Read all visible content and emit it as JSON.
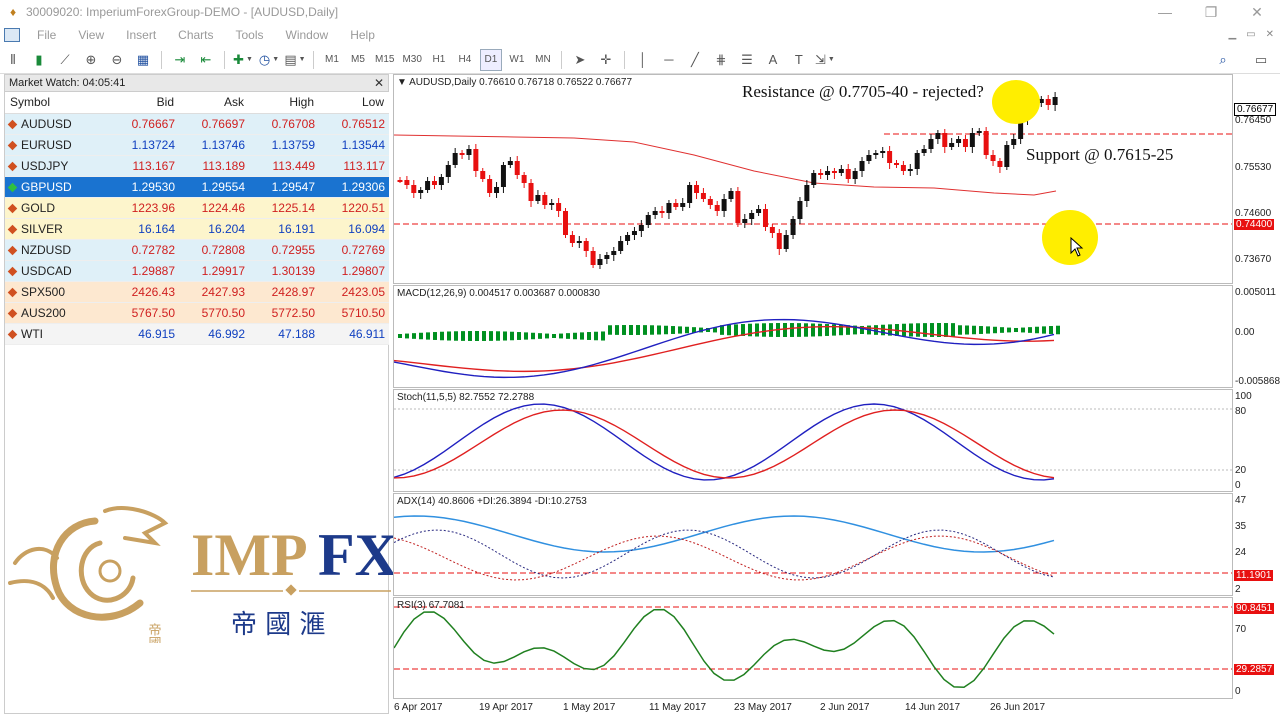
{
  "window": {
    "title": "30009020: ImperiumForexGroup-DEMO - [AUDUSD,Daily]",
    "buttons": [
      "—",
      "❐",
      "✕"
    ]
  },
  "menu": [
    "File",
    "View",
    "Insert",
    "Charts",
    "Tools",
    "Window",
    "Help"
  ],
  "toolbar": {
    "timeframes": [
      "M1",
      "M5",
      "M15",
      "M30",
      "H1",
      "H4",
      "D1",
      "W1",
      "MN"
    ],
    "active_timeframe": "D1"
  },
  "market_watch": {
    "title": "Market Watch: 04:05:41",
    "columns": [
      "Symbol",
      "Bid",
      "Ask",
      "High",
      "Low"
    ],
    "rows": [
      {
        "symbol": "AUDUSD",
        "bid": "0.76667",
        "ask": "0.76697",
        "high": "0.76708",
        "low": "0.76512",
        "bg": "#dff0f8",
        "color": "#d02020"
      },
      {
        "symbol": "EURUSD",
        "bid": "1.13724",
        "ask": "1.13746",
        "high": "1.13759",
        "low": "1.13544",
        "bg": "#dff0f8",
        "color": "#1040c0"
      },
      {
        "symbol": "USDJPY",
        "bid": "113.167",
        "ask": "113.189",
        "high": "113.449",
        "low": "113.117",
        "bg": "#dff0f8",
        "color": "#d02020"
      },
      {
        "symbol": "GBPUSD",
        "bid": "1.29530",
        "ask": "1.29554",
        "high": "1.29547",
        "low": "1.29306",
        "bg": "#1a73d0",
        "color": "#ffffff",
        "selected": true
      },
      {
        "symbol": "GOLD",
        "bid": "1223.96",
        "ask": "1224.46",
        "high": "1225.14",
        "low": "1220.51",
        "bg": "#fdf5cc",
        "color": "#d02020"
      },
      {
        "symbol": "SILVER",
        "bid": "16.164",
        "ask": "16.204",
        "high": "16.191",
        "low": "16.094",
        "bg": "#fdf5cc",
        "color": "#1040c0"
      },
      {
        "symbol": "NZDUSD",
        "bid": "0.72782",
        "ask": "0.72808",
        "high": "0.72955",
        "low": "0.72769",
        "bg": "#dff0f8",
        "color": "#d02020"
      },
      {
        "symbol": "USDCAD",
        "bid": "1.29887",
        "ask": "1.29917",
        "high": "1.30139",
        "low": "1.29807",
        "bg": "#dff0f8",
        "color": "#d02020"
      },
      {
        "symbol": "SPX500",
        "bid": "2426.43",
        "ask": "2427.93",
        "high": "2428.97",
        "low": "2423.05",
        "bg": "#fde8d0",
        "color": "#d02020"
      },
      {
        "symbol": "AUS200",
        "bid": "5767.50",
        "ask": "5770.50",
        "high": "5772.50",
        "low": "5710.50",
        "bg": "#fde8d0",
        "color": "#d02020"
      },
      {
        "symbol": "WTI",
        "bid": "46.915",
        "ask": "46.992",
        "high": "47.188",
        "low": "46.911",
        "bg": "#f4f4f4",
        "color": "#1040c0"
      }
    ]
  },
  "logo": {
    "text_a": "IMP",
    "text_b": "FX",
    "chinese": "帝 國 滙",
    "seal": "帝國"
  },
  "chart": {
    "price_label": "AUDUSD,Daily  0.76610 0.76718 0.76522 0.76677",
    "macd_label": "MACD(12,26,9) 0.004517 0.003687 0.000830",
    "stoch_label": "Stoch(11,5,5) 82.7552 72.2788",
    "adx_label": "ADX(14) 40.8606 +DI:26.3894 -DI:10.2753",
    "rsi_label": "RSI(3) 67.7081",
    "annotation_resistance": "Resistance @ 0.7705-40 - rejected?",
    "annotation_support": "Support @  0.7615-25",
    "price_scale": [
      "0.76450",
      "0.75530",
      "0.74600",
      "0.73670"
    ],
    "price_current": "0.76677",
    "price_line_tag": "0.74400",
    "macd_scale": [
      "0.005011",
      "0.00",
      "-0.005868"
    ],
    "stoch_scale": [
      "100",
      "80",
      "20",
      "0"
    ],
    "adx_scale": [
      "47",
      "35",
      "24",
      "2"
    ],
    "adx_tag": "11.1901",
    "rsi_scale": [
      "70",
      "0"
    ],
    "rsi_tag_high": "90.8451",
    "rsi_tag_low": "29.2857",
    "dates": [
      "6 Apr 2017",
      "19 Apr 2017",
      "1 May 2017",
      "11 May 2017",
      "23 May 2017",
      "2 Jun 2017",
      "14 Jun 2017",
      "26 Jun 2017"
    ]
  },
  "colors": {
    "bull": "#111111",
    "bear": "#e81010",
    "macd_signal": "#e02020",
    "macd_main": "#2020c0",
    "hist": "#009020",
    "rsi": "#208020",
    "adx": "#3090e0"
  }
}
